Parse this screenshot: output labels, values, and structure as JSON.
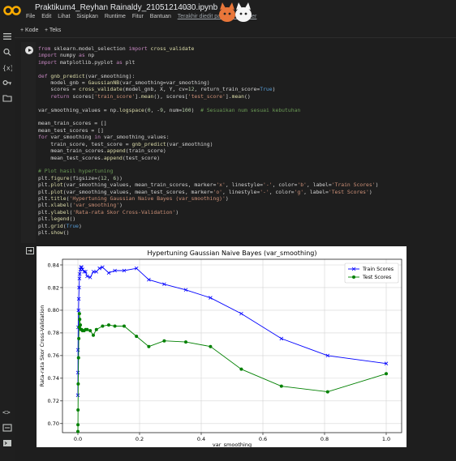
{
  "app": {
    "notebook_title": "Praktikum4_Reyhan Rainaldy_21051214030.ipynb",
    "menu": [
      "File",
      "Edit",
      "Lihat",
      "Sisipkan",
      "Runtime",
      "Fitur",
      "Bantuan"
    ],
    "last_edited": "Terakhir diedit pada 16 Oktober"
  },
  "toolbar": {
    "add_code": "+ Kode",
    "add_text": "+ Teks"
  },
  "colors": {
    "background": "#1e1e1e",
    "train": "#0000ff",
    "test": "#008000",
    "logo": "#f9ab00"
  },
  "code_lines": [
    "from sklearn.model_selection import cross_validate",
    "import numpy as np",
    "import matplotlib.pyplot as plt",
    "",
    "def gnb_predict(var_smoothing):",
    "    model_gnb = GaussianNB(var_smoothing=var_smoothing)",
    "    scores = cross_validate(model_gnb, X, Y, cv=12, return_train_score=True)",
    "    return scores['train_score'].mean(), scores['test_score'].mean()",
    "",
    "var_smoothing_values = np.logspace(0, -9, num=100)  # Sesuaikan num sesuai kebutuhan",
    "",
    "mean_train_scores = []",
    "mean_test_scores = []",
    "for var_smoothing in var_smoothing_values:",
    "    train_score, test_score = gnb_predict(var_smoothing)",
    "    mean_train_scores.append(train_score)",
    "    mean_test_scores.append(test_score)",
    "",
    "# Plot hasil hypertuning",
    "plt.figure(figsize=(12, 6))",
    "plt.plot(var_smoothing_values, mean_train_scores, marker='x', linestyle='-', color='b', label='Train Scores')",
    "plt.plot(var_smoothing_values, mean_test_scores, marker='o', linestyle='-', color='g', label='Test Scores')",
    "plt.title('Hypertuning Gaussian Naive Bayes (var_smoothing)')",
    "plt.xlabel('var_smoothing')",
    "plt.ylabel('Rata-rata Skor Cross-Validation')",
    "plt.legend()",
    "plt.grid(True)",
    "plt.show()"
  ],
  "chart_data": {
    "type": "line",
    "title": "Hypertuning Gaussian Naive Bayes (var_smoothing)",
    "xlabel": "var_smoothing",
    "ylabel": "Rata-rata Skor Cross-Validation",
    "xlim": [
      -0.05,
      1.05
    ],
    "ylim": [
      0.692,
      0.845
    ],
    "xticks": [
      0.0,
      0.2,
      0.4,
      0.6,
      0.8,
      1.0
    ],
    "xtick_labels": [
      "0.0",
      "0.2",
      "0.4",
      "0.6",
      "0.8",
      "1.0"
    ],
    "yticks": [
      0.7,
      0.72,
      0.74,
      0.76,
      0.78,
      0.8,
      0.82,
      0.84
    ],
    "ytick_labels": [
      "0.70",
      "0.72",
      "0.74",
      "0.76",
      "0.78",
      "0.80",
      "0.82",
      "0.84"
    ],
    "grid": true,
    "legend_position": "top-right",
    "series": [
      {
        "name": "Train Scores",
        "color": "#0000ff",
        "marker": "x",
        "x": [
          0.0,
          0.0002,
          0.0005,
          0.001,
          0.002,
          0.003,
          0.004,
          0.005,
          0.006,
          0.008,
          0.01,
          0.012,
          0.015,
          0.02,
          0.025,
          0.03,
          0.04,
          0.05,
          0.06,
          0.07,
          0.08,
          0.1,
          0.12,
          0.15,
          0.19,
          0.23,
          0.28,
          0.35,
          0.43,
          0.53,
          0.66,
          0.81,
          1.0
        ],
        "y": [
          0.725,
          0.745,
          0.765,
          0.785,
          0.8,
          0.81,
          0.82,
          0.828,
          0.832,
          0.836,
          0.838,
          0.838,
          0.836,
          0.834,
          0.834,
          0.83,
          0.829,
          0.834,
          0.834,
          0.837,
          0.838,
          0.833,
          0.835,
          0.835,
          0.837,
          0.827,
          0.823,
          0.818,
          0.811,
          0.797,
          0.775,
          0.76,
          0.753
        ]
      },
      {
        "name": "Test Scores",
        "color": "#008000",
        "marker": "o",
        "x": [
          0.0,
          0.0002,
          0.0005,
          0.001,
          0.002,
          0.003,
          0.004,
          0.005,
          0.006,
          0.008,
          0.01,
          0.012,
          0.015,
          0.02,
          0.025,
          0.03,
          0.04,
          0.05,
          0.06,
          0.08,
          0.1,
          0.12,
          0.15,
          0.19,
          0.23,
          0.28,
          0.35,
          0.43,
          0.53,
          0.66,
          0.81,
          1.0
        ],
        "y": [
          0.693,
          0.699,
          0.712,
          0.735,
          0.758,
          0.775,
          0.785,
          0.797,
          0.792,
          0.787,
          0.783,
          0.783,
          0.782,
          0.782,
          0.783,
          0.783,
          0.782,
          0.778,
          0.783,
          0.786,
          0.787,
          0.786,
          0.786,
          0.777,
          0.768,
          0.773,
          0.772,
          0.768,
          0.748,
          0.733,
          0.728,
          0.744
        ]
      }
    ]
  }
}
